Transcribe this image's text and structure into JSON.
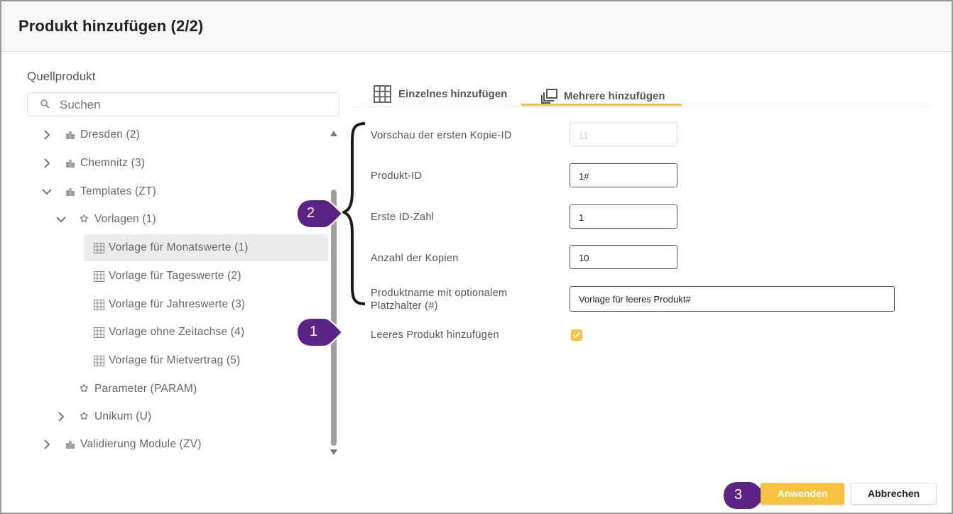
{
  "dialog": {
    "title": "Produkt hinzufügen (2/2)"
  },
  "source": {
    "label": "Quellprodukt",
    "search_placeholder": "Suchen",
    "tree": [
      {
        "label": "Dresden (2)",
        "icon": "building-icon",
        "expander": "chevron-right"
      },
      {
        "label": "Chemnitz (3)",
        "icon": "building-icon",
        "expander": "chevron-right"
      },
      {
        "label": "Templates (ZT)",
        "icon": "building-icon",
        "expander": "chevron-down"
      },
      {
        "label": "Vorlagen (1)",
        "icon": "gear-icon",
        "expander": "chevron-down"
      },
      {
        "label": "Vorlage für Monatswerte (1)",
        "icon": "grid-icon",
        "selected": true
      },
      {
        "label": "Vorlage für Tageswerte (2)",
        "icon": "grid-icon"
      },
      {
        "label": "Vorlage für Jahreswerte (3)",
        "icon": "grid-icon"
      },
      {
        "label": "Vorlage ohne Zeitachse (4)",
        "icon": "grid-icon"
      },
      {
        "label": "Vorlage für Mietvertrag (5)",
        "icon": "grid-icon"
      },
      {
        "label": "Parameter (PARAM)",
        "icon": "gear-icon"
      },
      {
        "label": "Unikum (U)",
        "icon": "gear-icon",
        "expander": "chevron-right"
      },
      {
        "label": "Validierung Module (ZV)",
        "icon": "building-icon",
        "expander": "chevron-right"
      }
    ]
  },
  "tabs": [
    {
      "label": "Einzelnes hinzufügen",
      "icon": "table-icon",
      "active": false
    },
    {
      "label": "Mehrere hinzufügen",
      "icon": "copy-multiple-icon",
      "active": true
    }
  ],
  "form": {
    "preview_label": "Vorschau der ersten Kopie-ID",
    "preview_value": "11",
    "product_id_label": "Produkt-ID",
    "product_id_value": "1#",
    "first_id_label": "Erste ID-Zahl",
    "first_id_value": "1",
    "copies_label": "Anzahl der Kopien",
    "copies_value": "10",
    "name_label_1": "Produktname mit optionalem",
    "name_label_2": "Platzhalter (#)",
    "name_value": "Vorlage für leeres Produkt#",
    "empty_product_label": "Leeres Produkt hinzufügen",
    "empty_product_checked": true
  },
  "annotations": {
    "badge_1": "1",
    "badge_2": "2",
    "badge_3": "3"
  },
  "buttons": {
    "apply": "Anwenden",
    "cancel": "Abbrechen"
  },
  "colors": {
    "accent": "#f5c242",
    "badge": "#5b2386",
    "selected_row": "#ececec"
  }
}
